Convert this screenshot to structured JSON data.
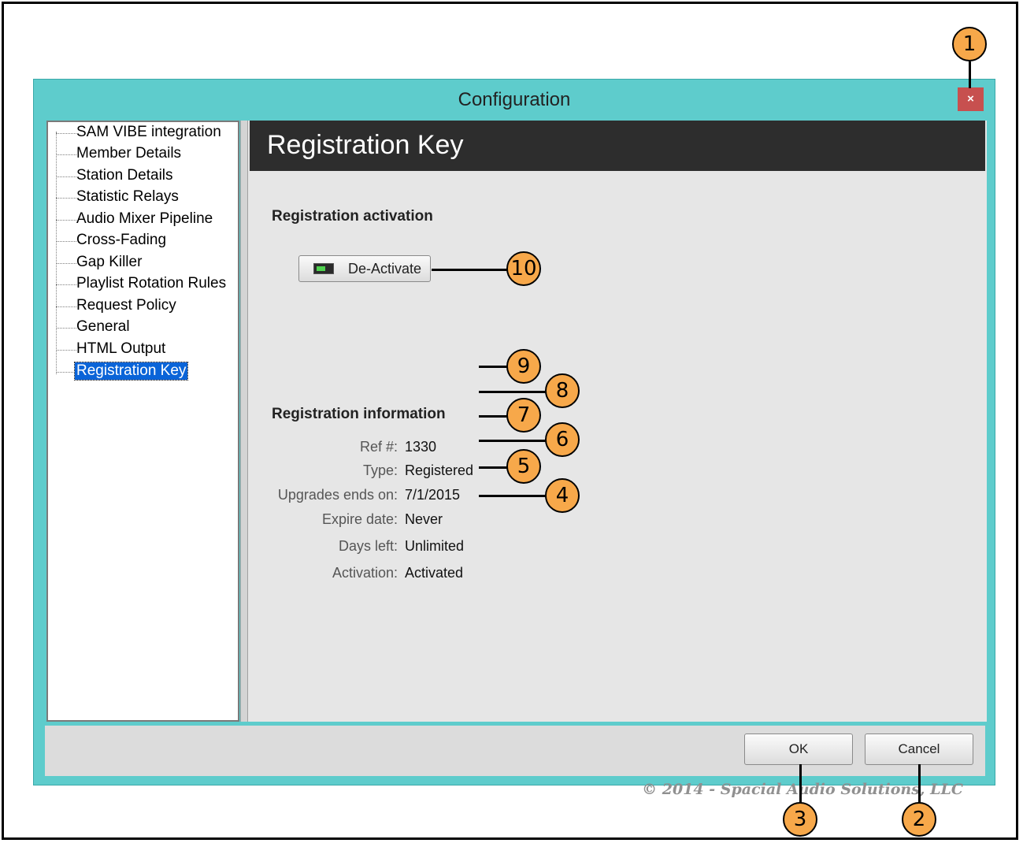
{
  "window": {
    "title": "Configuration",
    "close_label": "×"
  },
  "sidebar": {
    "items": [
      {
        "label": "SAM VIBE integration"
      },
      {
        "label": "Member Details"
      },
      {
        "label": "Station Details"
      },
      {
        "label": "Statistic Relays"
      },
      {
        "label": "Audio Mixer Pipeline"
      },
      {
        "label": "Cross-Fading"
      },
      {
        "label": "Gap Killer"
      },
      {
        "label": "Playlist Rotation Rules"
      },
      {
        "label": "Request Policy"
      },
      {
        "label": "General"
      },
      {
        "label": "HTML Output"
      },
      {
        "label": "Registration Key"
      }
    ],
    "selected": "Registration Key"
  },
  "main": {
    "header_title": "Registration Key",
    "activation_heading": "Registration activation",
    "deactivate_label": "De-Activate",
    "info_heading": "Registration information",
    "info": [
      {
        "label": "Ref #:",
        "value": "1330"
      },
      {
        "label": "Type:",
        "value": "Registered"
      },
      {
        "label": "Upgrades ends on:",
        "value": "7/1/2015"
      },
      {
        "label": "Expire date:",
        "value": "Never"
      },
      {
        "label": "Days left:",
        "value": "Unlimited"
      },
      {
        "label": "Activation:",
        "value": "Activated"
      }
    ],
    "copyright": "© 2014 - Spacial Audio Solutions, LLC"
  },
  "footer": {
    "ok_label": "OK",
    "cancel_label": "Cancel"
  },
  "callouts": {
    "c1": "1",
    "c2": "2",
    "c3": "3",
    "c4": "4",
    "c5": "5",
    "c6": "6",
    "c7": "7",
    "c8": "8",
    "c9": "9",
    "c10": "10"
  },
  "colors": {
    "window_frame": "#5ecccc",
    "close_button": "#c7504f",
    "header_bar": "#2d2d2d",
    "callout_fill": "#f7a84a",
    "selection": "#0a64d8"
  }
}
